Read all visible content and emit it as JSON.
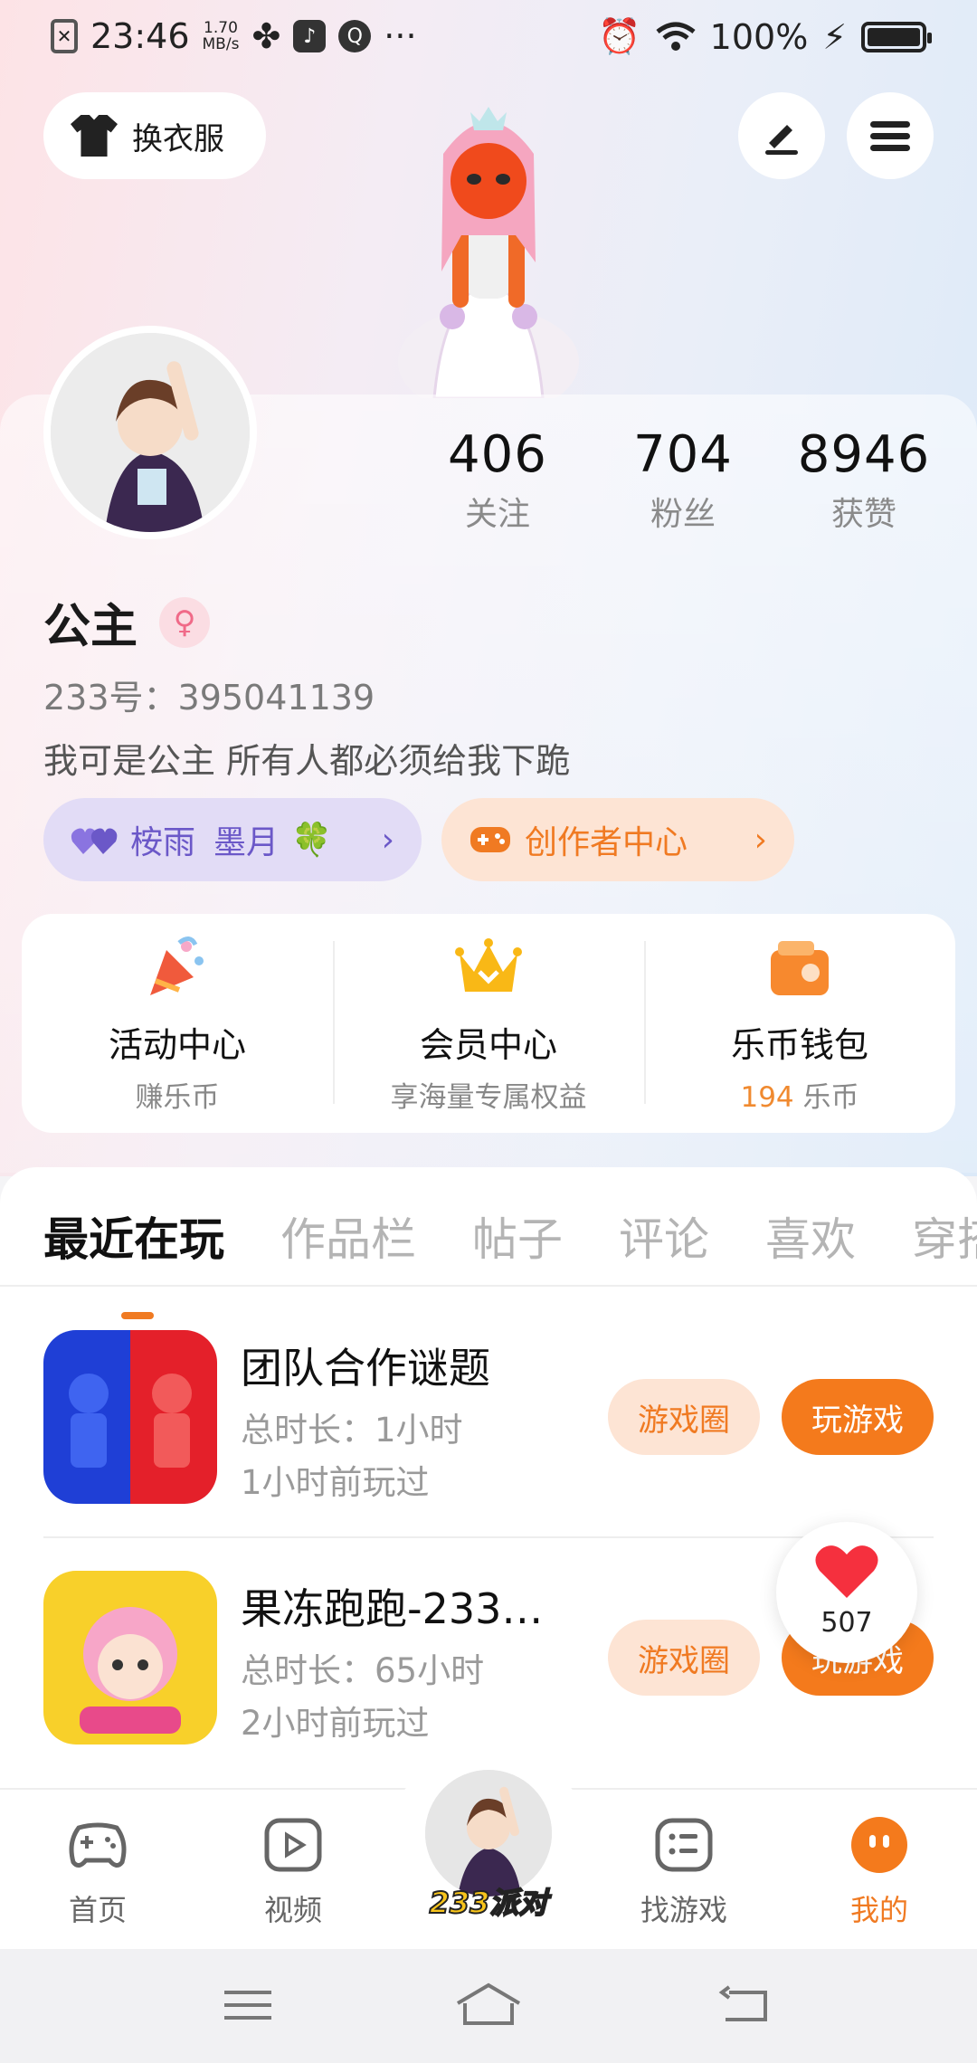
{
  "status_bar": {
    "time": "23:46",
    "net_speed_value": "1.70",
    "net_speed_unit": "MB/s",
    "battery": "100%",
    "left_icons": [
      "close-box-icon",
      "pinwheel-icon",
      "music-icon",
      "q-app-icon",
      "more-dots-icon"
    ],
    "right_icons": [
      "alarm-icon",
      "wifi-icon",
      "charging-icon",
      "battery-icon"
    ]
  },
  "header": {
    "outfit_label": "换衣服"
  },
  "profile": {
    "stats": [
      {
        "value": "406",
        "label": "关注"
      },
      {
        "value": "704",
        "label": "粉丝"
      },
      {
        "value": "8946",
        "label": "获赞"
      }
    ],
    "name": "公主",
    "gender": "female",
    "uid_text": "233号：395041139",
    "bio": "我可是公主 所有人都必须给我下跪",
    "friend_pill": {
      "name1": "桉雨",
      "name2": "墨月",
      "emoji": "🍀"
    },
    "creator_pill": "创作者中心"
  },
  "features": [
    {
      "title": "活动中心",
      "sub": "赚乐币",
      "icon": "party-popper-icon"
    },
    {
      "title": "会员中心",
      "sub": "享海量专属权益",
      "icon": "crown-icon"
    },
    {
      "title": "乐币钱包",
      "coin_value": "194",
      "coin_unit": " 乐币",
      "icon": "wallet-icon"
    }
  ],
  "tabs": [
    "最近在玩",
    "作品栏",
    "帖子",
    "评论",
    "喜欢",
    "穿搭"
  ],
  "active_tab": 0,
  "games": [
    {
      "title": "团队合作谜题",
      "duration": "总时长：1小时",
      "last_played": "1小时前玩过",
      "circle_label": "游戏圈",
      "play_label": "玩游戏"
    },
    {
      "title": "果冻跑跑-233…",
      "duration": "总时长：65小时",
      "last_played": "2小时前玩过",
      "circle_label": "游戏圈",
      "play_label": "玩游戏"
    }
  ],
  "like_float": {
    "count": "507"
  },
  "bottom_nav": {
    "home": "首页",
    "video": "视频",
    "center": "233派对",
    "find": "找游戏",
    "me": "我的"
  },
  "colors": {
    "accent": "#f47a1c",
    "purple": "#6b58c8",
    "pink": "#f06a88"
  }
}
